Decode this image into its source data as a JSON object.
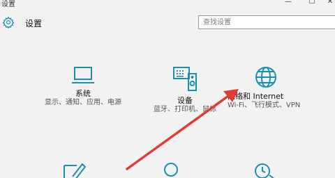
{
  "window": {
    "title": "设置",
    "minimize_glyph": "—",
    "maximize_glyph": "☐",
    "close_glyph": "✕"
  },
  "header": {
    "title": "设置",
    "icon": "gear-icon"
  },
  "search": {
    "placeholder": "查找设置",
    "value": ""
  },
  "tiles": [
    {
      "name": "系统",
      "desc": "显示、通知、应用、电源",
      "icon": "laptop-icon"
    },
    {
      "name": "设备",
      "desc": "蓝牙、打印机、鼠标",
      "icon": "devices-icon"
    },
    {
      "name": "网络和 Internet",
      "desc": "Wi-Fi、飞行模式、VPN",
      "icon": "globe-icon"
    }
  ],
  "bottom_tiles": [
    {
      "icon": "personalization-icon"
    },
    {
      "icon": "accounts-icon"
    },
    {
      "icon": "time-language-icon"
    }
  ],
  "colors": {
    "accent": "#1a8fb0",
    "arrow": "#e03c31",
    "background": "#f2f2f2"
  }
}
